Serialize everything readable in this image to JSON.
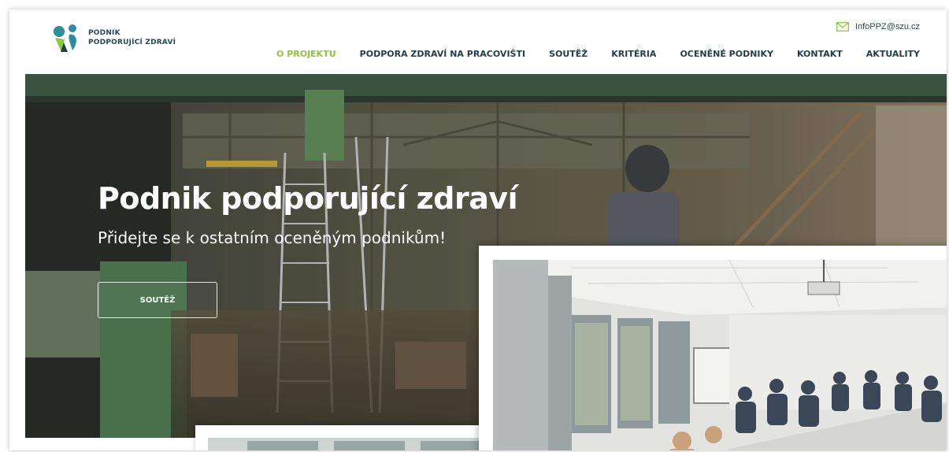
{
  "brand": {
    "line1": "PODNIK",
    "line2": "PODPORUJÍCÍ ZDRAVÍ",
    "colors": {
      "green": "#8cc63f",
      "teal": "#2a8f9a",
      "dark": "#1f3f4b"
    }
  },
  "contact": {
    "email": "InfoPPZ@szu.cz",
    "icon": "envelope-icon"
  },
  "nav": {
    "items": [
      {
        "label": "O PROJEKTU",
        "active": true
      },
      {
        "label": "PODPORA ZDRAVÍ NA PRACOVIŠTI",
        "active": false
      },
      {
        "label": "SOUTĚŽ",
        "active": false
      },
      {
        "label": "KRITÉRIA",
        "active": false
      },
      {
        "label": "OCENĚNÉ PODNIKY",
        "active": false
      },
      {
        "label": "KONTAKT",
        "active": false
      },
      {
        "label": "AKTUALITY",
        "active": false
      }
    ]
  },
  "hero": {
    "title": "Podnik podporující zdraví",
    "subtitle": "Přidejte se k ostatním oceněným podnikům!",
    "button_label": "SOUTĚŽ"
  }
}
